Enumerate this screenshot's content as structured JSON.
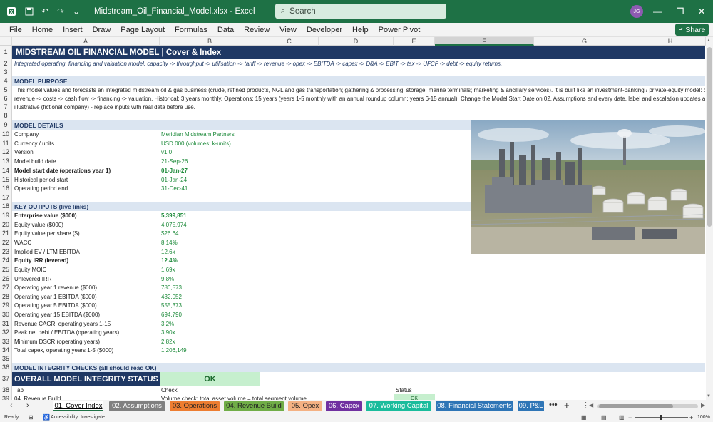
{
  "title_bar": {
    "filename": "Midstream_Oil_Financial_Model.xlsx  -  Excel",
    "search_placeholder": "Search",
    "avatar_initials": "JG"
  },
  "ribbon_tabs": [
    "File",
    "Home",
    "Insert",
    "Draw",
    "Page Layout",
    "Formulas",
    "Data",
    "Review",
    "View",
    "Developer",
    "Help",
    "Power Pivot"
  ],
  "share_label": "Share",
  "columns": [
    "A",
    "B",
    "C",
    "D",
    "E",
    "F",
    "G",
    "H"
  ],
  "rows": {
    "r1": {
      "n": "1",
      "title": "MIDSTREAM OIL FINANCIAL MODEL  |  Cover & Index"
    },
    "r2": {
      "n": "2",
      "text": "Integrated operating, financing and valuation model: capacity -> throughput -> utilisation -> tariff -> revenue -> opex -> EBITDA -> capex -> D&A -> EBIT -> tax -> UFCF -> debt -> equity returns."
    },
    "r3": {
      "n": "3"
    },
    "r4": {
      "n": "4",
      "text": "MODEL PURPOSE"
    },
    "r5": {
      "n": "5",
      "text": "This model values and forecasts an integrated midstream oil & gas business (crude, refined products, NGL and gas transportation; gathering & processing; storage; marine terminals; marketing & ancillary services). It is built like an investment-banking / private-equity model: operational dri"
    },
    "r6": {
      "n": "6",
      "text": "revenue -> costs -> cash flow -> financing -> valuation. Historical: 3 years monthly. Operations: 15 years (years 1-5 monthly with an annual roundup column; years 6-15 annual). Change the Model Start Date on 02. Assumptions and every date, label and escalation updates automatically. A"
    },
    "r7": {
      "n": "7",
      "text": "illustrative (fictional company) - replace inputs with real data before use."
    },
    "r8": {
      "n": "8"
    },
    "r9": {
      "n": "9",
      "text": "MODEL DETAILS"
    },
    "r10": {
      "n": "10",
      "label": "Company",
      "value": "Meridian Midstream Partners"
    },
    "r11": {
      "n": "11",
      "label": "Currency / units",
      "value": "USD 000 (volumes: k-units)"
    },
    "r12": {
      "n": "12",
      "label": "Version",
      "value": "v1.0"
    },
    "r13": {
      "n": "13",
      "label": "Model build date",
      "value": "21-Sep-26"
    },
    "r14": {
      "n": "14",
      "label": "Model start date (operations year 1)",
      "value": "01-Jan-27"
    },
    "r15": {
      "n": "15",
      "label": "Historical period start",
      "value": "01-Jan-24"
    },
    "r16": {
      "n": "16",
      "label": "Operating period end",
      "value": "31-Dec-41"
    },
    "r17": {
      "n": "17"
    },
    "r18": {
      "n": "18",
      "text": "KEY OUTPUTS  (live links)"
    },
    "r19": {
      "n": "19",
      "label": "Enterprise value ($000)",
      "value": "5,399,851"
    },
    "r20": {
      "n": "20",
      "label": "Equity value ($000)",
      "value": "4,075,974"
    },
    "r21": {
      "n": "21",
      "label": "Equity value per share ($)",
      "value": "$26.64"
    },
    "r22": {
      "n": "22",
      "label": "WACC",
      "value": "8.14%"
    },
    "r23": {
      "n": "23",
      "label": "Implied EV / LTM EBITDA",
      "value": "12.6x"
    },
    "r24": {
      "n": "24",
      "label": "Equity IRR (levered)",
      "value": "12.4%"
    },
    "r25": {
      "n": "25",
      "label": "Equity MOIC",
      "value": "1.69x"
    },
    "r26": {
      "n": "26",
      "label": "Unlevered IRR",
      "value": "9.8%"
    },
    "r27": {
      "n": "27",
      "label": "Operating year 1 revenue ($000)",
      "value": "780,573"
    },
    "r28": {
      "n": "28",
      "label": "Operating year 1 EBITDA ($000)",
      "value": "432,052"
    },
    "r29": {
      "n": "29",
      "label": "Operating year 5 EBITDA ($000)",
      "value": "555,373"
    },
    "r30": {
      "n": "30",
      "label": "Operating year 15 EBITDA ($000)",
      "value": "694,790"
    },
    "r31": {
      "n": "31",
      "label": "Revenue CAGR, operating years 1-15",
      "value": "3.2%"
    },
    "r32": {
      "n": "32",
      "label": "Peak net debt / EBITDA (operating years)",
      "value": "3.90x"
    },
    "r33": {
      "n": "33",
      "label": "Minimum DSCR (operating years)",
      "value": "2.82x"
    },
    "r34": {
      "n": "34",
      "label": "Total capex, operating years 1-5 ($000)",
      "value": "1,206,149"
    },
    "r35": {
      "n": "35"
    },
    "r36": {
      "n": "36",
      "text": "MODEL INTEGRITY CHECKS  (all should read OK)"
    },
    "r37": {
      "n": "37",
      "label": "OVERALL MODEL INTEGRITY STATUS",
      "value": "OK"
    },
    "r38": {
      "n": "38",
      "tab": "Tab",
      "check": "Check",
      "status": "Status"
    },
    "r39": {
      "n": "39",
      "tab": "04. Revenue Build",
      "check": "Volume check: total asset volume = total segment volume",
      "status": "OK"
    }
  },
  "sheet_tabs": [
    {
      "label": "01. Cover Index",
      "color": "#d9d9d9",
      "text": "#1f3864"
    },
    {
      "label": "02. Assumptions",
      "color": "#808080",
      "text": "#ffffff"
    },
    {
      "label": "03. Operations",
      "color": "#ed7d31",
      "text": "#222222"
    },
    {
      "label": "04. Revenue Build",
      "color": "#70ad47",
      "text": "#222222"
    },
    {
      "label": "05. Opex",
      "color": "#f4b183",
      "text": "#222222"
    },
    {
      "label": "06. Capex",
      "color": "#7030a0",
      "text": "#ffffff"
    },
    {
      "label": "07. Working Capital",
      "color": "#1abc9c",
      "text": "#ffffff"
    },
    {
      "label": "08. Financial Statements",
      "color": "#2e75b6",
      "text": "#ffffff"
    },
    {
      "label": "09. P&L",
      "color": "#2e75b6",
      "text": "#ffffff"
    }
  ],
  "status_bar": {
    "ready": "Ready",
    "accessibility": "Accessibility: Investigate",
    "zoom": "100%"
  },
  "colors": {
    "titlebar": "#1e7145",
    "navy": "#1f3864",
    "value_green": "#1d8a3a",
    "section_fill": "#dbe5f1",
    "ok_fill": "#c6efce"
  }
}
